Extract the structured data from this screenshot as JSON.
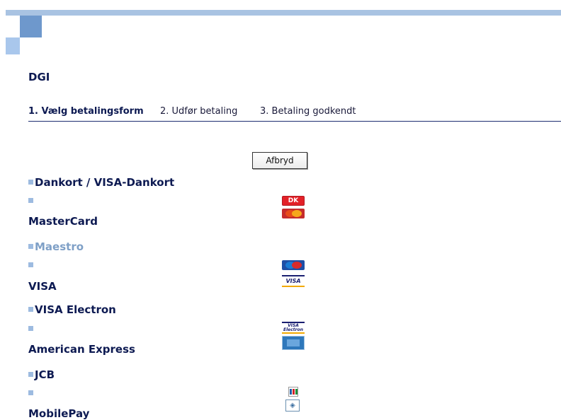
{
  "brand": "DGI",
  "steps": [
    {
      "label": "1. Vælg betalingsform",
      "active": true
    },
    {
      "label": "2. Udfør betaling",
      "active": false
    },
    {
      "label": "3. Betaling godkendt",
      "active": false
    }
  ],
  "cancel_label": "Afbryd",
  "payment_methods": [
    {
      "label": "Dankort / VISA-Dankort",
      "logo": "dankort-logo-icon"
    },
    {
      "label": "MasterCard",
      "logo": "mastercard-logo-icon"
    },
    {
      "label": "Maestro",
      "logo": "maestro-logo-icon"
    },
    {
      "label": "VISA",
      "logo": "visa-logo-icon"
    },
    {
      "label": "VISA Electron",
      "logo": "visa-electron-logo-icon"
    },
    {
      "label": "American Express",
      "logo": "american-express-logo-icon"
    },
    {
      "label": "JCB",
      "logo": "jcb-logo-icon"
    },
    {
      "label": "MobilePay",
      "logo": "mobilepay-logo-icon"
    }
  ],
  "logo_texts": {
    "dankort": "DK",
    "visa": "VISA",
    "visa_electron_top": "VISA",
    "visa_electron_bottom": "Electron",
    "mobilepay": "◈"
  },
  "colors": {
    "brand_navy": "#0d1a52",
    "accent_blue": "#9dbbe0",
    "hover_link": "#7fa0c7",
    "header_bar": "#a9c3e2"
  }
}
